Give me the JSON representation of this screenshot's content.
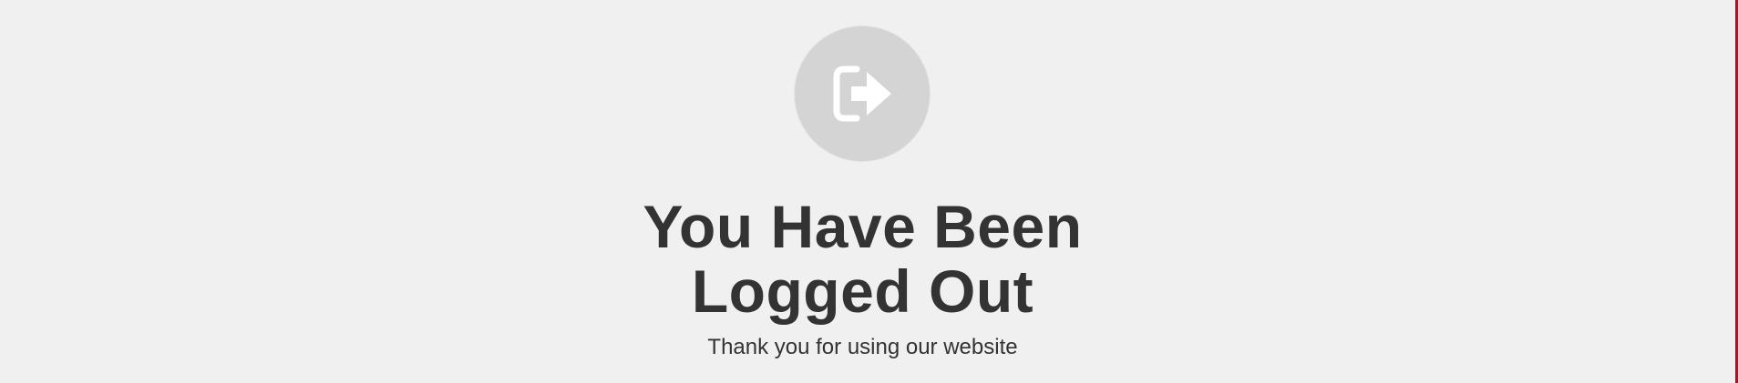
{
  "page": {
    "title_line_1": "You Have Been",
    "title_line_2": "Logged Out",
    "subtitle": "Thank you for using our website"
  },
  "icon": {
    "name": "logout-icon"
  },
  "colors": {
    "background": "#f0f0f0",
    "circle": "#d4d4d4",
    "icon": "#ffffff",
    "text": "#333333",
    "accent_edge": "#a0182a"
  }
}
